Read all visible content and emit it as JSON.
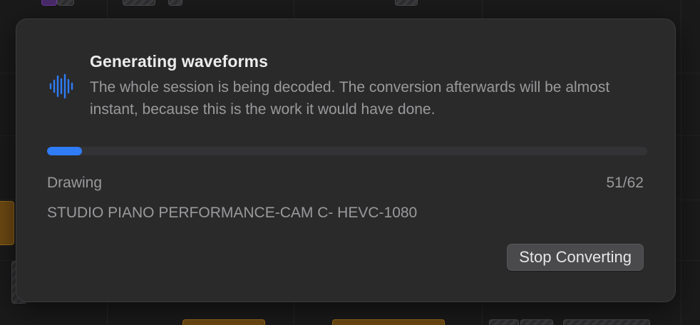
{
  "dialog": {
    "title": "Generating waveforms",
    "message": "The whole session is being decoded. The conversion afterwards will be almost instant, because this is the work it would have done.",
    "icon": "waveform-icon",
    "progress": {
      "fraction": 0.058,
      "label": "Drawing",
      "count": "51/62",
      "current_item": "STUDIO PIANO PERFORMANCE-CAM C- HEVC-1080"
    },
    "stop_button_label": "Stop Converting"
  },
  "colors": {
    "accent": "#2f7cf6",
    "sheet_background": "#2a2a2b",
    "title_text": "#ececec",
    "secondary_text": "#9a9a9c"
  }
}
